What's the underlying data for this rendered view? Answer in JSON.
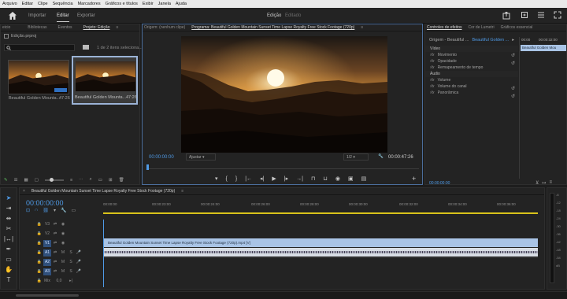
{
  "menu": [
    "Arquivo",
    "Editar",
    "Clipe",
    "Sequência",
    "Marcadores",
    "Gráficos e títulos",
    "Exibir",
    "Janela",
    "Ajuda"
  ],
  "workspace_tabs": {
    "import": "Importar",
    "edit": "Editar",
    "export": "Exportar"
  },
  "center_title": {
    "main": "Edição",
    "sub": "Editado"
  },
  "project_panel": {
    "tabs": [
      "eicio",
      "Bibliotecas",
      "Eventos",
      "Projeto: Edição"
    ],
    "project_file": "Edição.prproj",
    "count": "1 de 2 itens seleciona...",
    "items": [
      {
        "name": "Beautiful Golden Mounta...",
        "duration": "47:26"
      },
      {
        "name": "Beautiful Golden Mounta...",
        "duration": "47:26"
      }
    ]
  },
  "monitor": {
    "source_tab": "Origem: (nenhum clipe)",
    "program_tab": "Programa: Beautiful Golden Mountain Sunset Time Lapse Royalty Free Stock Footage (720p)",
    "timecode_left": "00:00:00:00",
    "fit": "Ajustar",
    "resolution": "1/2",
    "timecode_right": "00:00:47:26"
  },
  "effects_panel": {
    "tabs": [
      "Controles de efeitos",
      "Cor de Lumetri",
      "Gráficos essencial"
    ],
    "source": "Origem - Beautiful ...",
    "target": "Beautiful Golden ...",
    "video_label": "Vídeo",
    "video_items": [
      "Movimento",
      "Opacidade",
      "Remapeamento de tempo"
    ],
    "audio_label": "Áudio",
    "audio_items": [
      "Volume",
      "Volume do canal",
      "Panorâmica"
    ],
    "mini_times": [
      "00:00",
      "00:00:32:00"
    ],
    "mini_clip": "Beautiful Golden Mou",
    "timecode": "00:00:00:00"
  },
  "timeline": {
    "sequence_tab": "Beautiful Golden Mountain Sunset Time Lapse Royalty Free Stock Footage (720p)",
    "timecode": "00:00:00:00",
    "ruler": [
      "00:00:00",
      "00:00:23:00",
      "00:00:24:00",
      "00:00:26:00",
      "00:00:28:00",
      "00:00:30:00",
      "00:00:32:00",
      "00:00:34:00",
      "00:00:36:00"
    ],
    "tracks": [
      {
        "label": "V3"
      },
      {
        "label": "V2"
      },
      {
        "label": "V1"
      },
      {
        "label": "A1"
      },
      {
        "label": "A2"
      },
      {
        "label": "A3"
      }
    ],
    "master": {
      "label": "Mix",
      "value": "0,0"
    },
    "video_clip": "Beautiful Golden Mountain Sunset Time Lapse Royalty Free Stock Footage (720p).mp4 [V]",
    "meter_ticks": [
      "-6",
      "-12",
      "-18",
      "-24",
      "-30",
      "-36",
      "-42",
      "-48",
      "-54"
    ],
    "meter_bottom": "dB"
  },
  "colors": {
    "accent": "#4f9ae6",
    "clip": "#a9c4e6",
    "bg": "#1d1d1d"
  }
}
